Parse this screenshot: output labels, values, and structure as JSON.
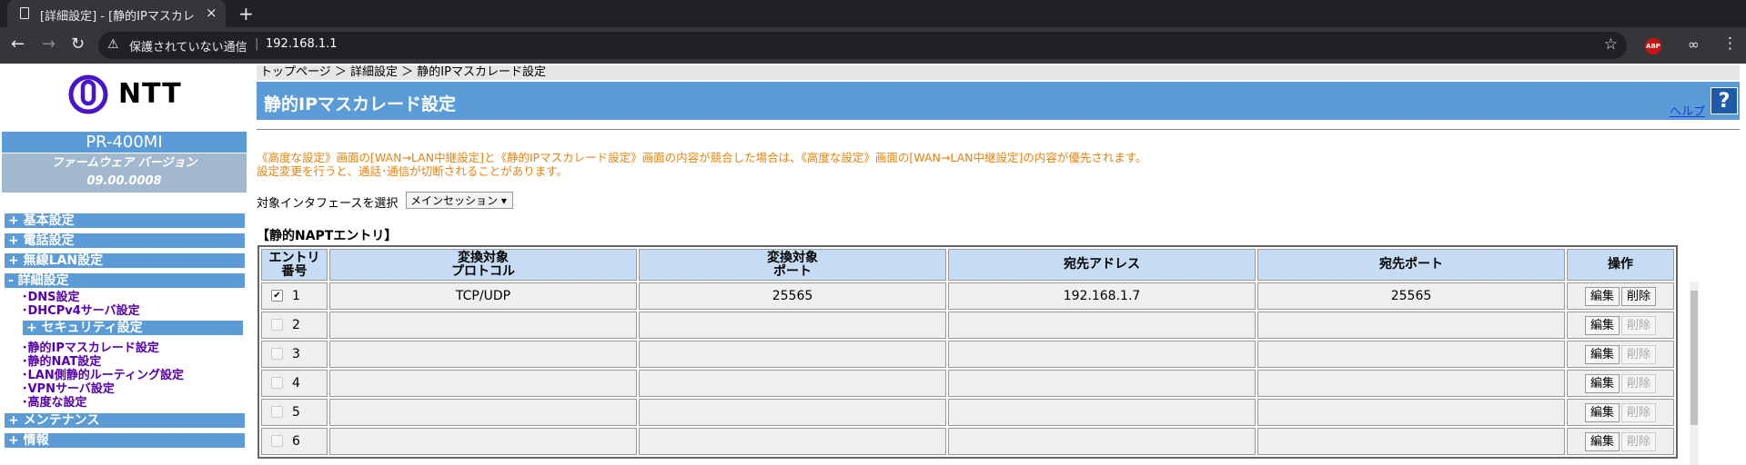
{
  "browser": {
    "tab_title": "[詳細設定] - [静的IPマスカレ",
    "tab_close": "×",
    "new_tab": "+",
    "security_text": "保護されていない通信",
    "url": "192.168.1.1",
    "abp_badge": "ABP"
  },
  "sidebar": {
    "logo_text": "NTT",
    "model": "PR-400MI",
    "firmware_label": "ファームウェア バージョン",
    "firmware_version": "09.00.0008",
    "menu": [
      {
        "label": "+ 基本設定"
      },
      {
        "label": "+ 電話設定"
      },
      {
        "label": "+ 無線LAN設定"
      },
      {
        "label": "- 詳細設定"
      }
    ],
    "advanced_items_1": [
      "･DNS設定",
      "･DHCPv4サーバ設定"
    ],
    "security_sub": "+ セキュリティ設定",
    "advanced_items_2": [
      "･静的IPマスカレード設定",
      "･静的NAT設定",
      "･LAN側静的ルーティング設定",
      "･VPNサーバ設定",
      "･高度な設定"
    ],
    "menu_bottom": [
      {
        "label": "+ メンテナンス"
      },
      {
        "label": "+ 情報"
      }
    ]
  },
  "main": {
    "breadcrumb": "トップページ ＞ 詳細設定 ＞ 静的IPマスカレード設定",
    "title": "静的IPマスカレード設定",
    "help_link": "ヘルプ",
    "help_icon": "?",
    "notice_line1": "《高度な設定》画面の[WAN→LAN中継設定]と《静的IPマスカレード設定》画面の内容が競合した場合は、《高度な設定》画面の[WAN→LAN中継設定]の内容が優先されます。",
    "notice_line2": "設定変更を行うと、通話･通信が切断されることがあります。",
    "interface_label": "対象インタフェースを選択",
    "interface_value": "メインセッション ▾",
    "section_title": "【静的NAPTエントリ】",
    "table": {
      "headers": {
        "entry_line1": "エントリ",
        "entry_line2": "番号",
        "protocol_line1": "変換対象",
        "protocol_line2": "プロトコル",
        "port_line1": "変換対象",
        "port_line2": "ポート",
        "dest_addr": "宛先アドレス",
        "dest_port": "宛先ポート",
        "ops": "操作"
      },
      "rows": [
        {
          "num": "1",
          "checked": "✔",
          "protocol": "TCP/UDP",
          "port": "25565",
          "dest_addr": "192.168.1.7",
          "dest_port": "25565",
          "edit": "編集",
          "delete": "削除"
        },
        {
          "num": "2",
          "checked": "",
          "protocol": "",
          "port": "",
          "dest_addr": "",
          "dest_port": "",
          "edit": "編集",
          "delete": "削除"
        },
        {
          "num": "3",
          "checked": "",
          "protocol": "",
          "port": "",
          "dest_addr": "",
          "dest_port": "",
          "edit": "編集",
          "delete": "削除"
        },
        {
          "num": "4",
          "checked": "",
          "protocol": "",
          "port": "",
          "dest_addr": "",
          "dest_port": "",
          "edit": "編集",
          "delete": "削除"
        },
        {
          "num": "5",
          "checked": "",
          "protocol": "",
          "port": "",
          "dest_addr": "",
          "dest_port": "",
          "edit": "編集",
          "delete": "削除"
        },
        {
          "num": "6",
          "checked": "",
          "protocol": "",
          "port": "",
          "dest_addr": "",
          "dest_port": "",
          "edit": "編集",
          "delete": "削除"
        }
      ]
    }
  }
}
